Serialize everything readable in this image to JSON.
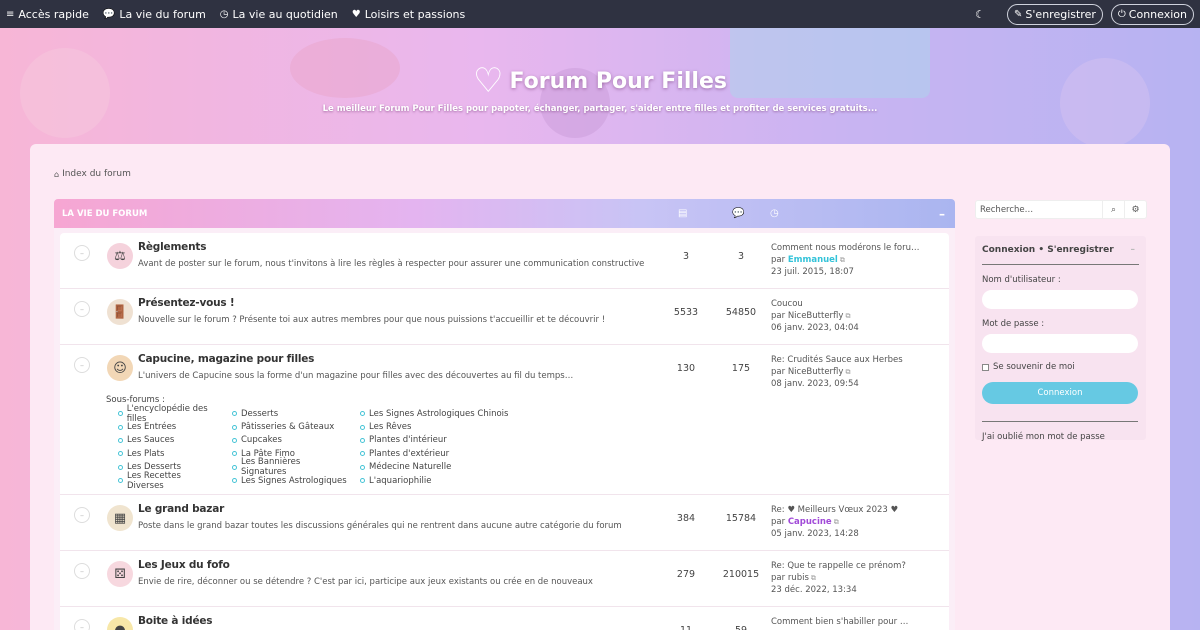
{
  "nav": {
    "items": [
      {
        "icon": "bars-icon",
        "glyph": "≡",
        "label": "Accès rapide"
      },
      {
        "icon": "comments-icon",
        "glyph": "💬",
        "label": "La vie du forum"
      },
      {
        "icon": "clock-icon",
        "glyph": "◷",
        "label": "La vie au quotidien"
      },
      {
        "icon": "heart-icon",
        "glyph": "♥",
        "label": "Loisirs et passions"
      }
    ],
    "theme_glyph": "☾",
    "register_label": "S'enregistrer",
    "login_label": "Connexion"
  },
  "banner": {
    "title": "Forum Pour Filles",
    "tagline": "Le meilleur Forum Pour Filles pour papoter, échanger, partager, s'aider entre filles et profiter de services gratuits..."
  },
  "breadcrumb": {
    "label": "Index du forum"
  },
  "category": {
    "name": "LA VIE DU FORUM",
    "collapse": "–",
    "forums": [
      {
        "title": "Règlements",
        "icon": "scales-icon",
        "glyph": "⚖",
        "icon_color": "#f5d2dc",
        "desc": "Avant de poster sur le forum, nous t'invitons à lire les règles à respecter pour assurer une communication constructive",
        "topics": "3",
        "posts": "3",
        "last_title": "Comment nous modérons le foru…",
        "last_by": "par ",
        "last_user": "Emmanuel",
        "user_class": "user-cyan",
        "last_date": "23 juil. 2015, 18:07"
      },
      {
        "title": "Présentez-vous !",
        "icon": "door-icon",
        "glyph": "🚪",
        "icon_color": "#efe1d2",
        "desc": "Nouvelle sur le forum ? Présente toi aux autres membres pour que nous puissions t'accueillir et te découvrir !",
        "topics": "5533",
        "posts": "54850",
        "last_title": "Coucou",
        "last_by": "par ",
        "last_user": "NiceButterfly",
        "user_class": "",
        "last_date": "06 janv. 2023, 04:04"
      },
      {
        "title": "Capucine, magazine pour filles",
        "icon": "girl-avatar-icon",
        "glyph": "☺",
        "icon_color": "#f2d7b6",
        "desc": "L'univers de Capucine sous la forme d'un magazine pour filles avec des découvertes au fil du temps…",
        "topics": "130",
        "posts": "175",
        "last_title": "Re: Crudités Sauce aux Herbes",
        "last_by": "par ",
        "last_user": "NiceButterfly",
        "user_class": "",
        "last_date": "08 janv. 2023, 09:54",
        "subforums_label": "Sous-forums :",
        "subforums": [
          [
            "L'encyclopédie des filles",
            "Les Entrées",
            "Les Sauces",
            "Les Plats",
            "Les Desserts",
            "Les Recettes Diverses"
          ],
          [
            "Desserts",
            "Pâtisseries & Gâteaux",
            "Cupcakes",
            "La Pâte Fimo",
            "Les Bannières Signatures",
            "Les Signes Astrologiques"
          ],
          [
            "Les Signes Astrologiques Chinois",
            "Les Rêves",
            "Plantes d'intérieur",
            "Plantes d'extérieur",
            "Médecine Naturelle",
            "L'aquariophilie"
          ]
        ]
      },
      {
        "title": "Le grand bazar",
        "icon": "bazaar-icon",
        "glyph": "▦",
        "icon_color": "#f0e4cf",
        "desc": "Poste dans le grand bazar toutes les discussions générales qui ne rentrent dans aucune autre catégorie du forum",
        "topics": "384",
        "posts": "15784",
        "last_title": "Re: ♥ Meilleurs Vœux 2023 ♥",
        "last_by": "par ",
        "last_user": "Capucine",
        "user_class": "user-purple",
        "last_date": "05 janv. 2023, 14:28"
      },
      {
        "title": "Les Jeux du fofo",
        "icon": "dice-icon",
        "glyph": "⚄",
        "icon_color": "#f7d8df",
        "desc": "Envie de rire, déconner ou se détendre ? C'est par ici, participe aux jeux existants ou crée en de nouveaux",
        "topics": "279",
        "posts": "210015",
        "last_title": "Re: Que te rappelle ce prénom?",
        "last_by": "par ",
        "last_user": "rubis",
        "user_class": "",
        "last_date": "23 déc. 2022, 13:34"
      },
      {
        "title": "Boite à idées",
        "icon": "lightbulb-icon",
        "glyph": "●",
        "icon_color": "#f7e7a8",
        "desc": "",
        "topics": "11",
        "posts": "59",
        "last_title": "Comment bien s'habiller pour …",
        "last_by": "",
        "last_user": "",
        "user_class": "",
        "last_date": ""
      }
    ]
  },
  "search": {
    "placeholder": "Recherche…"
  },
  "login": {
    "heading": "Connexion • S'enregistrer",
    "username_label": "Nom d'utilisateur :",
    "password_label": "Mot de passe :",
    "remember_label": "Se souvenir de moi",
    "button_label": "Connexion",
    "forgot_label": "J'ai oublié mon mot de passe"
  },
  "colors": {
    "nav_bg": "#2f3241",
    "accent_cyan": "#66c9e3",
    "panel_bg": "#fde9f4"
  }
}
